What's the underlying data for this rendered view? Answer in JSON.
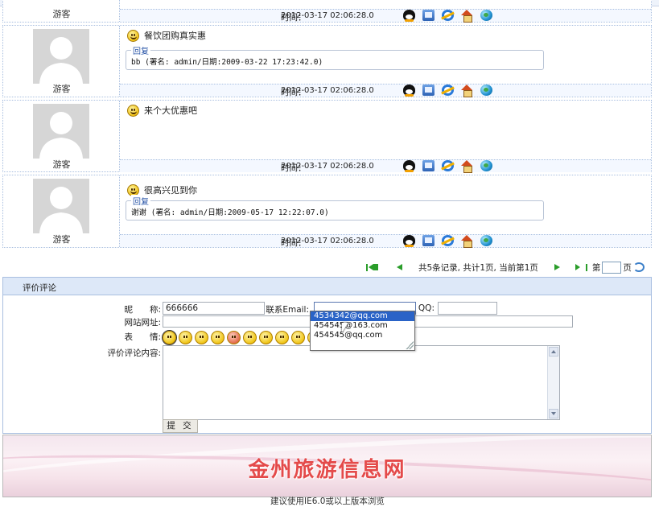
{
  "entries": [
    {
      "name": "游客",
      "time_label": "时间：",
      "time": "2012-03-17 02:06:28.0"
    },
    {
      "name": "游客",
      "message": "餐饮团购真实惠",
      "reply_legend": "回复",
      "reply_text": "bb (署名: admin/日期:2009-03-22 17:23:42.0)",
      "time_label": "时间：",
      "time": "2012-03-17 02:06:28.0"
    },
    {
      "name": "游客",
      "message": "来个大优惠吧",
      "time_label": "时间：",
      "time": "2012-03-17 02:06:28.0"
    },
    {
      "name": "游客",
      "message": "很高兴见到你",
      "reply_legend": "回复",
      "reply_text": "谢谢 (署名: admin/日期:2009-05-17 12:22:07.0)",
      "time_label": "时间：",
      "time": "2012-03-17 02:06:28.0"
    }
  ],
  "contact_icons": [
    "qq-icon",
    "msn-icon",
    "ie-icon",
    "home-icon",
    "earth-icon"
  ],
  "pager": {
    "summary": "共5条记录, 共计1页, 当前第1页",
    "page_prefix": "第",
    "page_suffix": "页"
  },
  "form": {
    "section_title": "评价评论",
    "nickname_label": "昵　　称:",
    "nickname_value": "666666",
    "email_label": "联系Email:",
    "email_value": "",
    "qq_label": "QQ:",
    "qq_value": "",
    "website_label": "网站网址:",
    "website_value": "",
    "expression_label": "表　　情:",
    "content_label": "评价评论内容:",
    "submit_label": "提 交"
  },
  "email_suggestions": [
    {
      "text": "4534342@qq.com",
      "highlighted": true
    },
    {
      "text": "454545@163.com",
      "highlighted": false
    },
    {
      "text": "454545@qq.com",
      "highlighted": false
    }
  ],
  "banner": {
    "title": "金州旅游信息网"
  },
  "bottom_note": "建议使用IE6.0或以上版本浏览"
}
